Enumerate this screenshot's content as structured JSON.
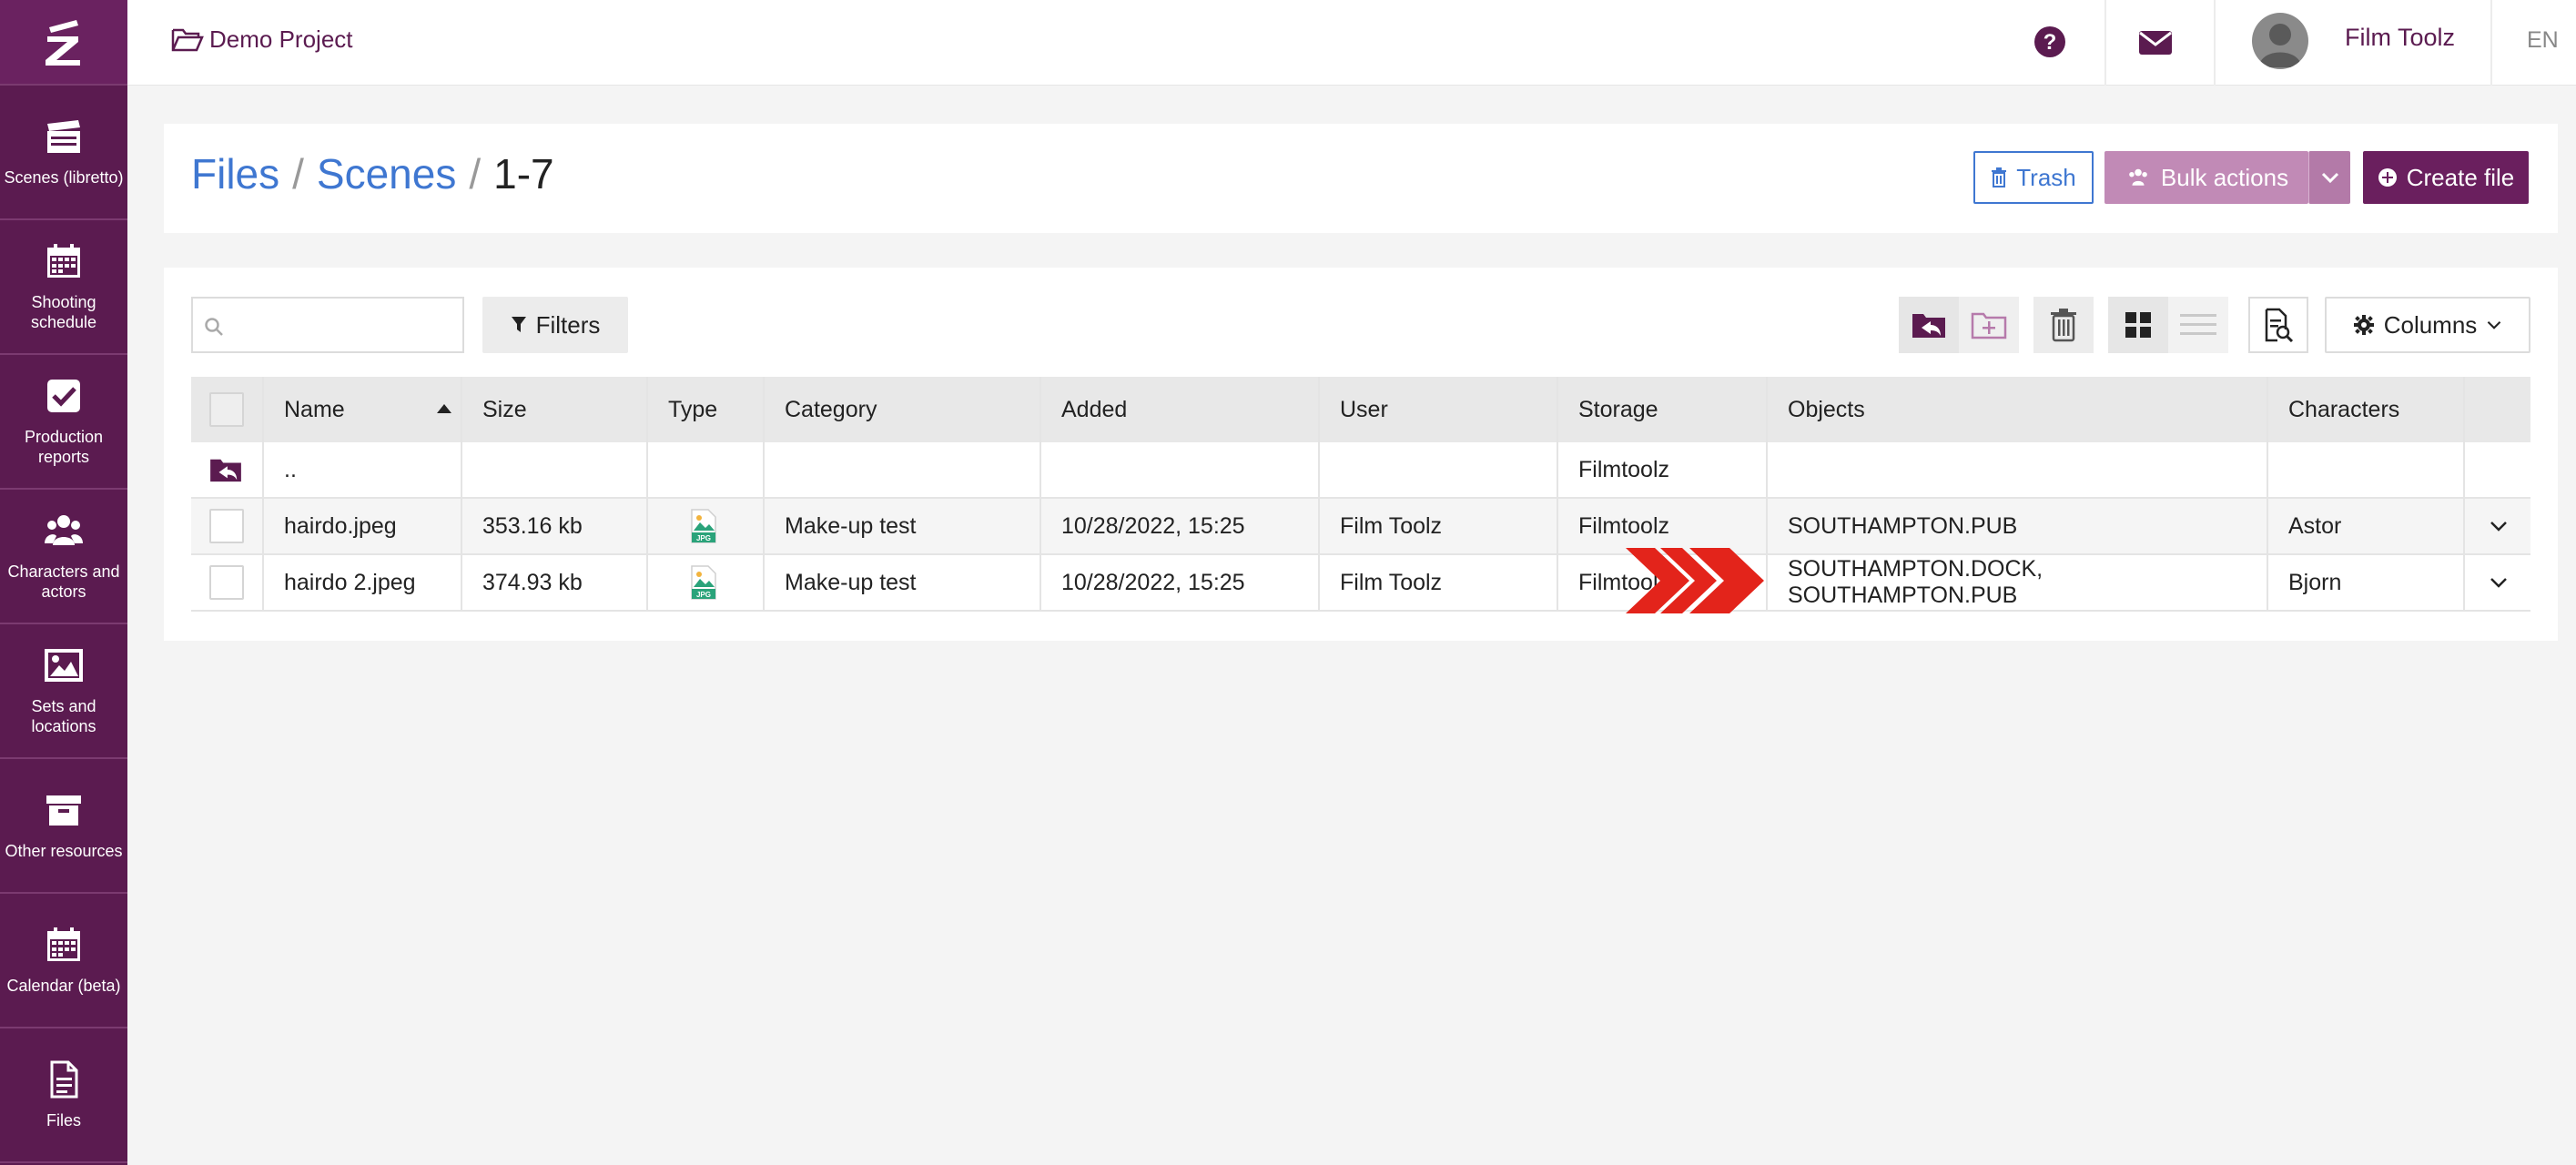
{
  "sidebar": {
    "items": [
      {
        "label": "Scenes (libretto)",
        "icon": "clapperboard-icon"
      },
      {
        "label": "Shooting schedule",
        "icon": "calendar-icon"
      },
      {
        "label": "Production reports",
        "icon": "check-square-icon"
      },
      {
        "label": "Characters and actors",
        "icon": "users-icon"
      },
      {
        "label": "Sets and locations",
        "icon": "image-icon"
      },
      {
        "label": "Other resources",
        "icon": "archive-icon"
      },
      {
        "label": "Calendar (beta)",
        "icon": "calendar-icon"
      },
      {
        "label": "Files",
        "icon": "file-icon"
      }
    ]
  },
  "topbar": {
    "project": "Demo Project",
    "user": "Film Toolz",
    "lang": "EN"
  },
  "breadcrumb": {
    "files": "Files",
    "scenes": "Scenes",
    "current": "1-7",
    "sep": "/"
  },
  "actions": {
    "trash": "Trash",
    "bulk": "Bulk actions",
    "create": "Create file"
  },
  "toolbar": {
    "search_placeholder": "",
    "filters": "Filters",
    "columns": "Columns"
  },
  "table": {
    "headers": [
      "Name",
      "Size",
      "Type",
      "Category",
      "Added",
      "User",
      "Storage",
      "Objects",
      "Characters"
    ],
    "parent_row": {
      "name": "..",
      "storage": "Filmtoolz"
    },
    "rows": [
      {
        "name": "hairdo.jpeg",
        "size": "353.16 kb",
        "type": "JPG",
        "category": "Make-up test",
        "added": "10/28/2022, 15:25",
        "user": "Film Toolz",
        "storage": "Filmtoolz",
        "objects": "SOUTHAMPTON.PUB",
        "characters": "Astor"
      },
      {
        "name": "hairdo 2.jpeg",
        "size": "374.93 kb",
        "type": "JPG",
        "category": "Make-up test",
        "added": "10/28/2022, 15:25",
        "user": "Film Toolz",
        "storage": "Filmtoolz",
        "objects": "SOUTHAMPTON.DOCK, SOUTHAMPTON.PUB",
        "characters": "Bjorn"
      }
    ]
  },
  "colors": {
    "brand": "#5b1b50",
    "link": "#3f77d1",
    "accent_arrow": "#e3241b"
  }
}
